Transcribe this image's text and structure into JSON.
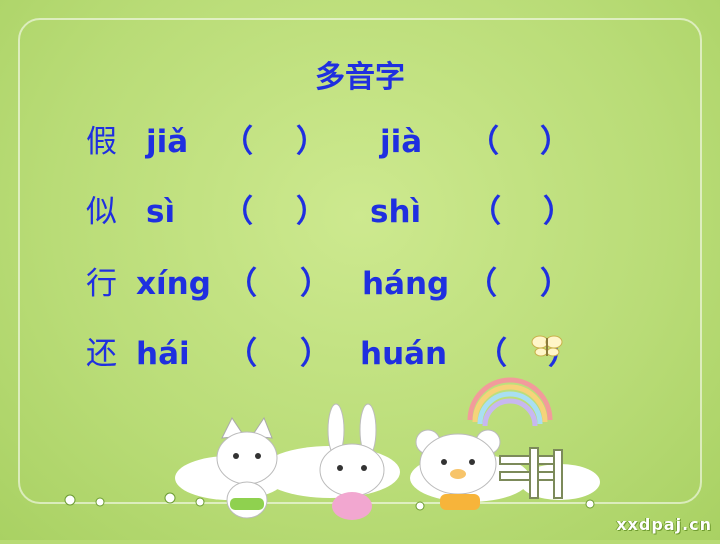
{
  "title": "多音字",
  "rows": [
    {
      "char": "假",
      "py1": "jiǎ",
      "open1": "（",
      "close1": "）",
      "py2": "jià",
      "open2": "（",
      "close2": "）"
    },
    {
      "char": "似",
      "py1": "sì",
      "open1": "（",
      "close1": "）",
      "py2": "shì",
      "open2": "（",
      "close2": "）"
    },
    {
      "char": "行",
      "py1": "xíng",
      "open1": "（",
      "close1": "）",
      "py2": "háng",
      "open2": "（",
      "close2": "）"
    },
    {
      "char": "还",
      "py1": "hái",
      "open1": "（",
      "close1": "）",
      "py2": "huán",
      "open2": "（",
      "close2": "）"
    }
  ],
  "watermark": "xxdpaj.cn",
  "colors": {
    "text": "#1f2fe0",
    "background": "#b7da74"
  },
  "decor_icons": [
    "rainbow-icon",
    "cat-icon",
    "rabbit-icon",
    "bear-icon",
    "fence-icon",
    "flower-icon",
    "butterfly-icon"
  ]
}
